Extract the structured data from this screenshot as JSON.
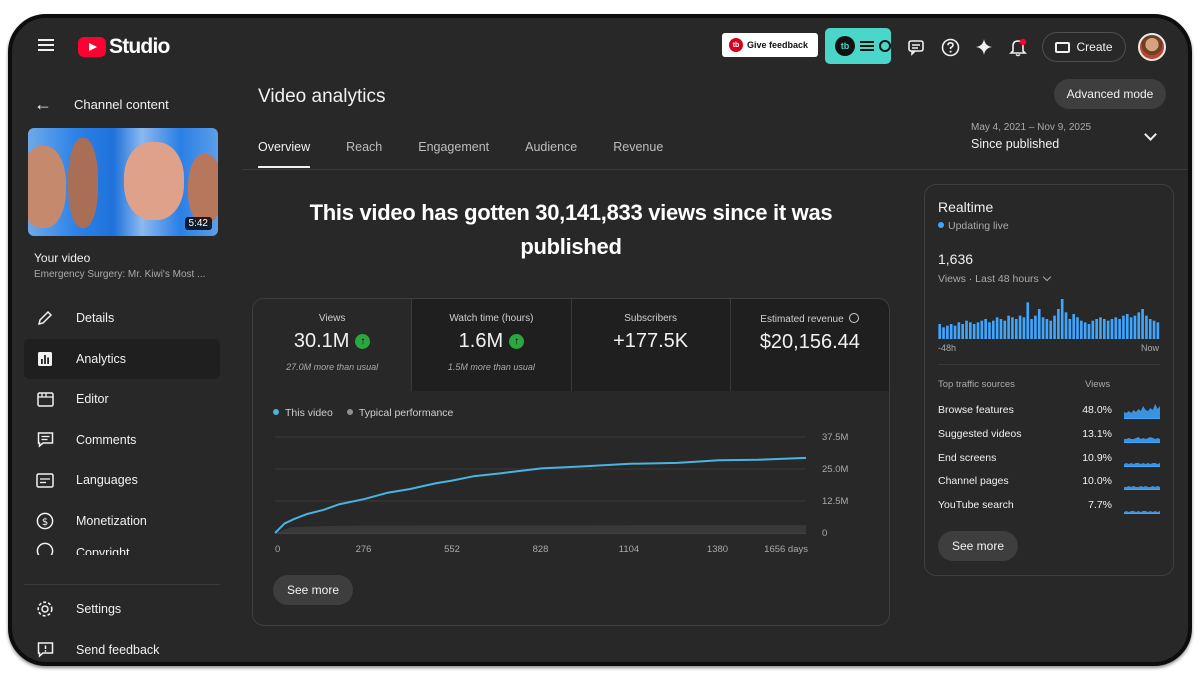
{
  "header": {
    "logo_text": "Studio",
    "give_feedback": "Give feedback",
    "tb_badge": "tb",
    "create_label": "Create"
  },
  "sidebar": {
    "back_label": "Channel content",
    "video_duration": "5:42",
    "your_video": "Your video",
    "video_title": "Emergency Surgery: Mr. Kiwi's Most ...",
    "items": [
      {
        "label": "Details",
        "icon": "pencil-icon"
      },
      {
        "label": "Analytics",
        "icon": "analytics-icon"
      },
      {
        "label": "Editor",
        "icon": "editor-icon"
      },
      {
        "label": "Comments",
        "icon": "comments-icon"
      },
      {
        "label": "Languages",
        "icon": "languages-icon"
      },
      {
        "label": "Monetization",
        "icon": "dollar-icon"
      },
      {
        "label": "Copyright",
        "icon": "copyright-icon"
      }
    ],
    "bottom": [
      {
        "label": "Settings",
        "icon": "gear-icon"
      },
      {
        "label": "Send feedback",
        "icon": "feedback-icon"
      }
    ]
  },
  "main": {
    "title": "Video analytics",
    "advanced_mode": "Advanced mode",
    "tabs": [
      "Overview",
      "Reach",
      "Engagement",
      "Audience",
      "Revenue"
    ],
    "date_range": "May 4, 2021 – Nov 9, 2025",
    "date_preset": "Since published",
    "headline": "This video has gotten 30,141,833 views since it was published"
  },
  "metrics": [
    {
      "label": "Views",
      "value": "30.1M",
      "up": true,
      "sub": "27.0M more than usual"
    },
    {
      "label": "Watch time (hours)",
      "value": "1.6M",
      "up": true,
      "sub": "1.5M more than usual"
    },
    {
      "label": "Subscribers",
      "value": "+177.5K",
      "up": false,
      "sub": ""
    },
    {
      "label": "Estimated revenue",
      "value": "$20,156.44",
      "up": false,
      "sub": ""
    }
  ],
  "chart_legend": {
    "this_video": "This video",
    "typical": "Typical performance"
  },
  "see_more": "See more",
  "colors": {
    "accent": "#3ea6ff",
    "series_line": "#49b4e0",
    "up_badge": "#2ba640",
    "brand_red": "#ff0033",
    "tb_teal": "#4ad7c9"
  },
  "chart_data": {
    "type": "line",
    "xlabel": "",
    "ylabel": "",
    "x_ticks": [
      "0",
      "276",
      "552",
      "828",
      "1104",
      "1380",
      "1656 days"
    ],
    "y_ticks": [
      "0",
      "12.5M",
      "25.0M",
      "37.5M"
    ],
    "ylim": [
      0,
      37500000
    ],
    "xlim": [
      0,
      1650
    ],
    "series": [
      {
        "name": "This video",
        "x": [
          0,
          30,
          60,
          100,
          150,
          200,
          276,
          350,
          420,
          500,
          552,
          620,
          700,
          828,
          950,
          1104,
          1250,
          1380,
          1500,
          1650
        ],
        "y": [
          0,
          3500000,
          5500000,
          7200000,
          9000000,
          11000000,
          13200000,
          15500000,
          17200000,
          19200000,
          20500000,
          22000000,
          23300000,
          25000000,
          26000000,
          26800000,
          27400000,
          28200000,
          28600000,
          29100000
        ]
      },
      {
        "name": "Typical performance",
        "x": [
          0,
          50,
          150,
          276,
          552,
          828,
          1104,
          1380,
          1650
        ],
        "y": [
          0,
          2300000,
          2700000,
          2900000,
          3000000,
          3000000,
          3050000,
          3100000,
          3100000
        ]
      }
    ],
    "grid": true,
    "legend": "top-left"
  },
  "realtime": {
    "title": "Realtime",
    "status": "Updating live",
    "count": "1,636",
    "views_label": "Views · Last 48 hours",
    "axis_start": "-48h",
    "axis_end": "Now",
    "bars": [
      9,
      7,
      8,
      9,
      8,
      10,
      9,
      11,
      10,
      9,
      10,
      11,
      12,
      10,
      11,
      13,
      12,
      11,
      14,
      13,
      12,
      14,
      13,
      22,
      12,
      14,
      18,
      13,
      12,
      11,
      14,
      18,
      24,
      16,
      12,
      15,
      13,
      11,
      10,
      9,
      11,
      12,
      13,
      12,
      11,
      12,
      13,
      12,
      14,
      15,
      13,
      14,
      16,
      18,
      14,
      12,
      11,
      10
    ],
    "traffic_head": "Top traffic sources",
    "traffic_views_head": "Views",
    "traffic": [
      {
        "name": "Browse features",
        "pct": "48.0%"
      },
      {
        "name": "Suggested videos",
        "pct": "13.1%"
      },
      {
        "name": "End screens",
        "pct": "10.9%"
      },
      {
        "name": "Channel pages",
        "pct": "10.0%"
      },
      {
        "name": "YouTube search",
        "pct": "7.7%"
      }
    ],
    "see_more": "See more"
  }
}
